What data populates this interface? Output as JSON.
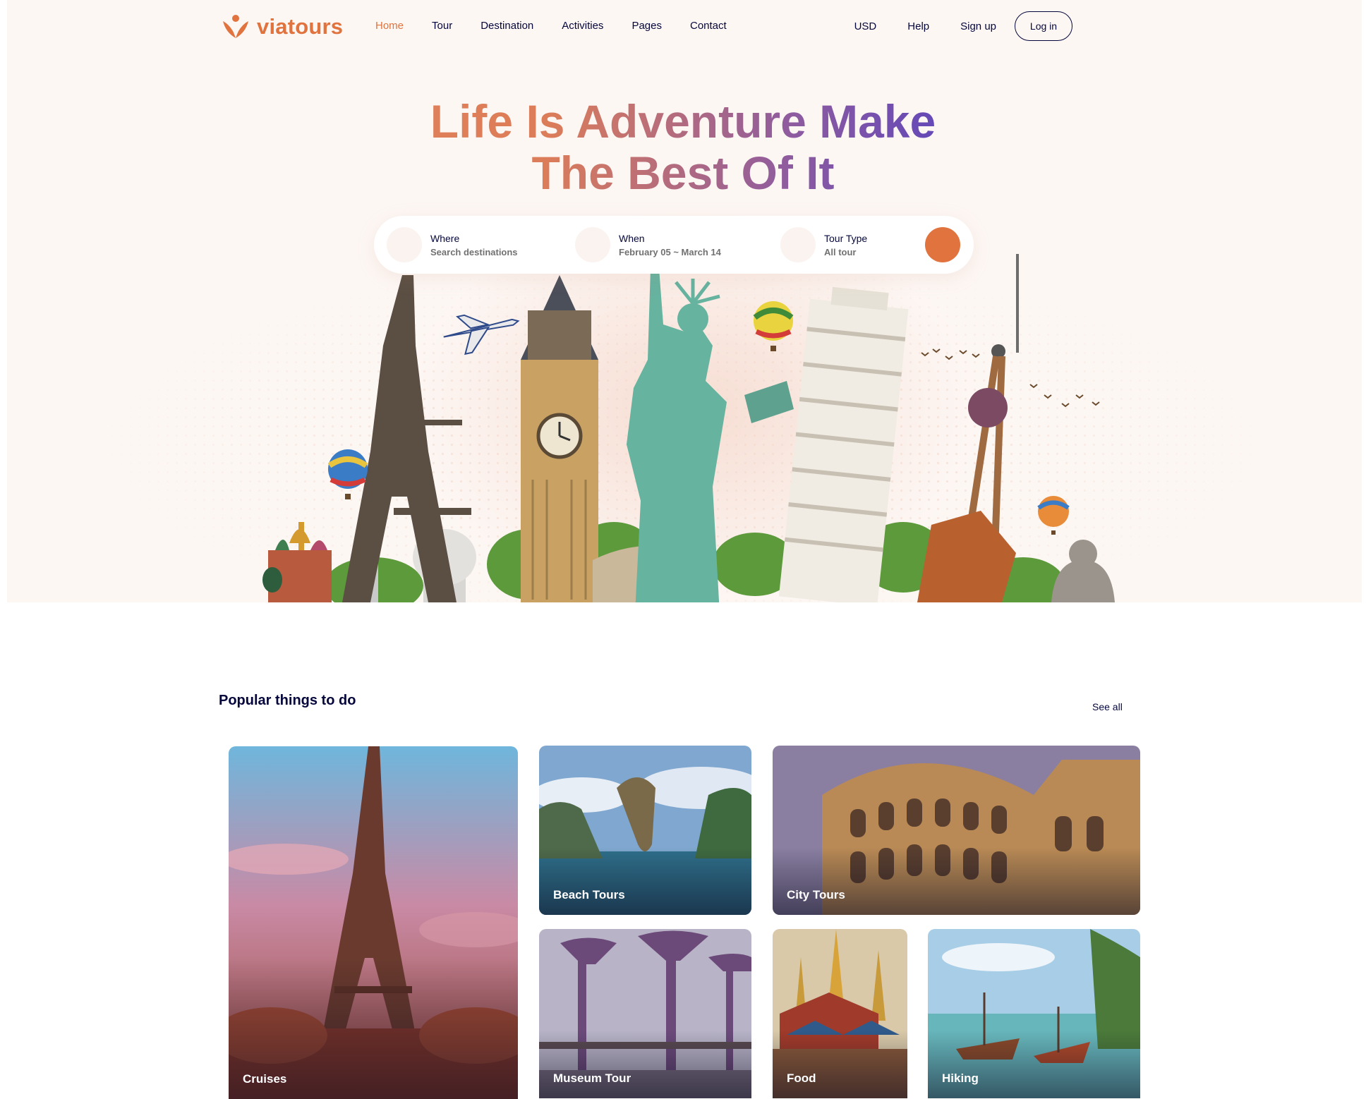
{
  "brand": {
    "name": "viatours"
  },
  "nav": {
    "items": [
      {
        "label": "Home",
        "active": true
      },
      {
        "label": "Tour"
      },
      {
        "label": "Destination"
      },
      {
        "label": "Activities"
      },
      {
        "label": "Pages"
      },
      {
        "label": "Contact"
      }
    ]
  },
  "header_right": {
    "currency": "USD",
    "help": "Help",
    "signup": "Sign up",
    "login": "Log in"
  },
  "hero": {
    "line1": "Life Is Adventure Make",
    "line2": "The Best Of It"
  },
  "search": {
    "where": {
      "label": "Where",
      "value": "Search destinations"
    },
    "when": {
      "label": "When",
      "value": "February 05 ~ March 14"
    },
    "tour_type": {
      "label": "Tour Type",
      "value": "All tour"
    }
  },
  "popular": {
    "title": "Popular things to do",
    "see_all": "See all",
    "cards": [
      {
        "label": "Cruises"
      },
      {
        "label": "Beach Tours"
      },
      {
        "label": "City Tours"
      },
      {
        "label": "Museum Tour"
      },
      {
        "label": "Food"
      },
      {
        "label": "Hiking"
      }
    ]
  },
  "colors": {
    "accent": "#e0733e",
    "text": "#05073c",
    "hero_bg": "#fdf7f4",
    "gradient_end": "#4f3fc4"
  }
}
